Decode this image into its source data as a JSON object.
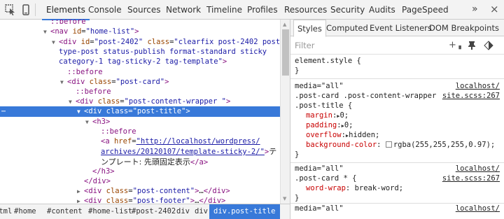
{
  "toolbar": {
    "icons": [
      "inspect-icon",
      "device-mode-icon"
    ],
    "tabs": [
      "Elements",
      "Console",
      "Sources",
      "Network",
      "Timeline",
      "Profiles",
      "Resources",
      "Security",
      "Audits",
      "PageSpeed"
    ],
    "active_tab": "Elements",
    "overflow": "»",
    "close": "×"
  },
  "dom": {
    "before1": "::before",
    "nav_tag": "nav",
    "nav_attr": "id",
    "nav_val": "\"home-list\"",
    "article_tag": "div",
    "article_attr1": "id",
    "article_val1": "\"post-2402\"",
    "article_attr2": "class",
    "article_val2a": "\"clearfix post-2402 post",
    "article_val2b": "type-post status-publish format-standard sticky",
    "article_val2c": "category-1 tag-sticky-2 tag-template\"",
    "before2": "::before",
    "card_tag": "div",
    "card_attr": "class",
    "card_val": "\"post-card\"",
    "before3": "::before",
    "wrapper_tag": "div",
    "wrapper_attr": "class",
    "wrapper_val": "\"post-content-wrapper \"",
    "title_tag": "div",
    "title_attr": "class",
    "title_val": "\"post-title\"",
    "h3_open": "<h3>",
    "before4": "::before",
    "a_tag": "a",
    "a_attr": "href",
    "a_val1": "\"http://localhost/wordpress/",
    "a_val2": "archives/20120107/template-sticky-2/\"",
    "a_text1": "テ",
    "a_text2": "ンプレート: 先頭固定表示",
    "a_close": "</a>",
    "h3_close": "</h3>",
    "div_close": "</div>",
    "content_tag": "div",
    "content_attr": "class",
    "content_val": "\"post-content\"",
    "footer_tag": "div",
    "footer_attr": "class",
    "footer_val": "\"post-footer\"",
    "ellipsis": "…"
  },
  "breadcrumbs": [
    "html",
    "#home",
    "#content",
    "#home-list",
    "#post-2402",
    "div",
    "div",
    "div.post-title"
  ],
  "styles": {
    "tabs": [
      "Styles",
      "Computed",
      "Event Listeners",
      "DOM Breakpoints"
    ],
    "active_tab": "Styles",
    "filter_placeholder": "Filter",
    "filter_icons": [
      "add-rule-icon",
      "pin-icon",
      "color-format-icon"
    ],
    "element_style": "element.style {",
    "close_brace": "}",
    "rule1": {
      "media": "media=\"all\"",
      "source1": "localhost/",
      "source2": "site.scss:267",
      "selector1": ".post-card .post-content-wrapper",
      "selector2": ".post-title {",
      "props": [
        {
          "name": "margin",
          "value": "0;",
          "triangle": true
        },
        {
          "name": "padding",
          "value": "0;",
          "triangle": true
        },
        {
          "name": "overflow",
          "value": "hidden;",
          "triangle": true
        },
        {
          "name": "background-color",
          "value": "rgba(255,255,255,0.97);",
          "swatch": true
        }
      ]
    },
    "rule2": {
      "media": "media=\"all\"",
      "source1": "localhost/",
      "source2": "site.scss:267",
      "selector": ".post-card * {",
      "props": [
        {
          "name": "word-wrap",
          "value": "break-word;"
        }
      ]
    },
    "rule3": {
      "media": "media=\"all\"",
      "source1": "localhost/"
    }
  },
  "colors": {
    "selection": "#3879d9",
    "tag": "#881280",
    "attribute": "#994500",
    "value": "#1a1aa6",
    "property": "#c80000"
  }
}
